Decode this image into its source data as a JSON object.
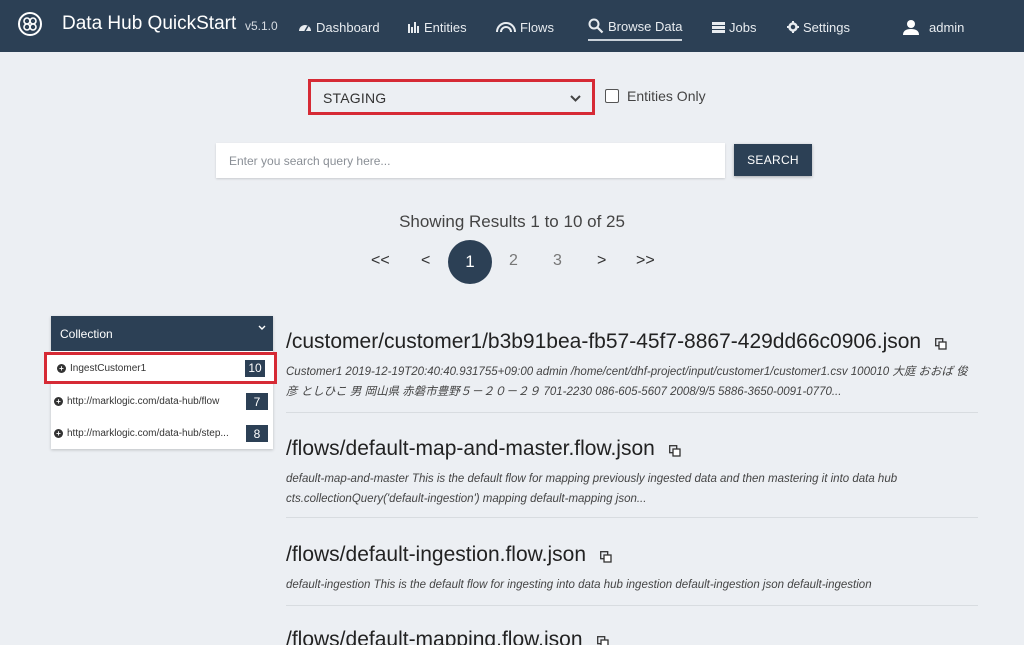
{
  "app": {
    "title": "Data Hub QuickStart",
    "version": "v5.1.0"
  },
  "nav": {
    "dashboard": "Dashboard",
    "entities": "Entities",
    "flows": "Flows",
    "browse": "Browse Data",
    "jobs": "Jobs",
    "settings": "Settings",
    "user": "admin"
  },
  "database": {
    "selected": "STAGING"
  },
  "entities_only": {
    "label": "Entities Only",
    "checked": false
  },
  "search": {
    "placeholder": "Enter you search query here...",
    "value": "",
    "button": "SEARCH"
  },
  "results_summary": "Showing Results 1 to 10 of 25",
  "pagination": {
    "first": "<<",
    "prev": "<",
    "pages": [
      "1",
      "2",
      "3"
    ],
    "current": "1",
    "next": ">",
    "last": ">>"
  },
  "facets": {
    "title": "Collection",
    "items": [
      {
        "name": "IngestCustomer1",
        "count": "10"
      },
      {
        "name": "http://marklogic.com/data-hub/flow",
        "count": "7"
      },
      {
        "name": "http://marklogic.com/data-hub/step...",
        "count": "8"
      }
    ]
  },
  "results": [
    {
      "uri": "/customer/customer1/b3b91bea-fb57-45f7-8867-429dd66c0906.json",
      "snippet": "Customer1 2019-12-19T20:40:40.931755+09:00 admin /home/cent/dhf-project/input/customer1/customer1.csv 100010 大庭 おおば 俊彦 としひこ 男 岡山県 赤磐市豊野５－２０－２９ 701-2230 086-605-5607 2008/9/5 5886-3650-0091-0770..."
    },
    {
      "uri": "/flows/default-map-and-master.flow.json",
      "snippet": "default-map-and-master This is the default flow for mapping previously ingested data and then mastering it into data hub cts.collectionQuery('default-ingestion') mapping default-mapping json..."
    },
    {
      "uri": "/flows/default-ingestion.flow.json",
      "snippet": "default-ingestion This is the default flow for ingesting into data hub ingestion default-ingestion json default-ingestion"
    },
    {
      "uri": "/flows/default-mapping.flow.json",
      "snippet": ""
    }
  ],
  "colors": {
    "navy": "#2c4055",
    "highlight": "#d62a35",
    "background": "#eceff3"
  }
}
